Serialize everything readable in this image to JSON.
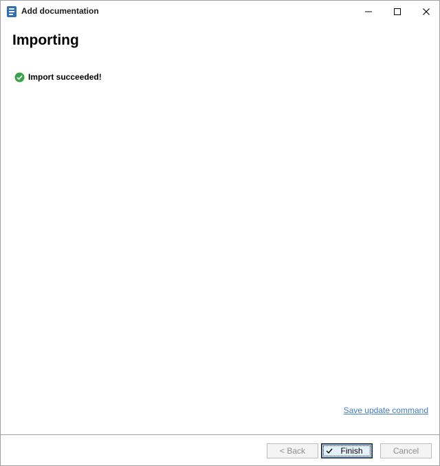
{
  "window": {
    "title": "Add documentation",
    "app_icon": "document-stack-icon",
    "controls": {
      "minimize_icon": "minimize-icon",
      "maximize_icon": "maximize-icon",
      "close_icon": "close-icon"
    }
  },
  "page": {
    "heading": "Importing",
    "status": {
      "icon": "check-circle-icon",
      "text": "Import succeeded!",
      "color": "#3aa24a"
    },
    "link": "Save update command"
  },
  "footer": {
    "back_label": "< Back",
    "finish_label": "Finish",
    "finish_icon": "checkmark-icon",
    "cancel_label": "Cancel"
  },
  "colors": {
    "accent": "#2f6fb5",
    "link": "#3f7cc0",
    "success": "#3aa24a"
  }
}
